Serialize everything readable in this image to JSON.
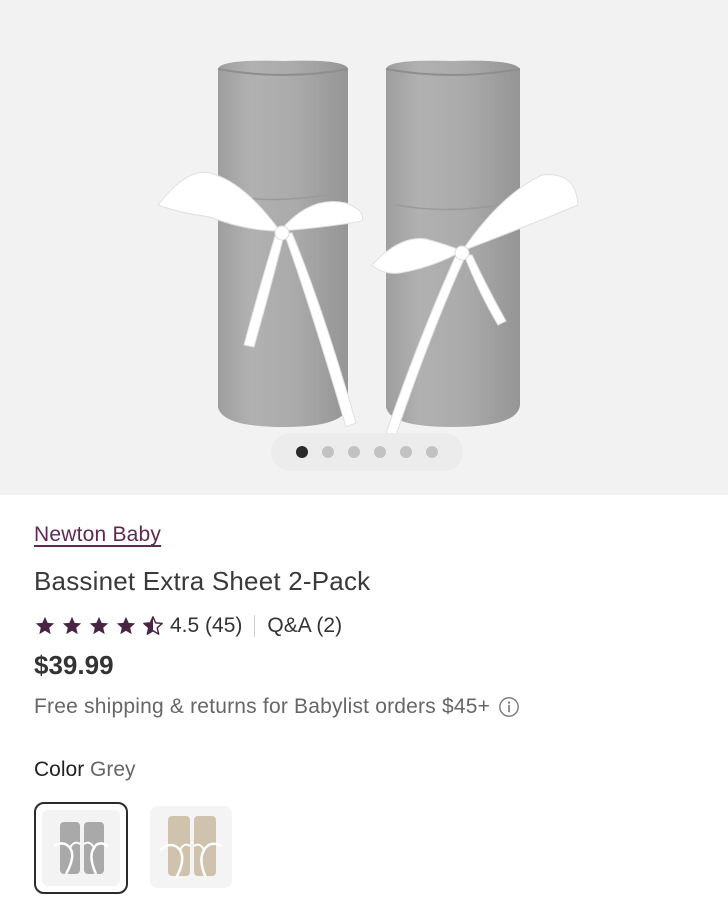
{
  "product": {
    "brand": "Newton Baby",
    "title": "Bassinet Extra Sheet 2-Pack",
    "rating_value": 4.5,
    "rating_text": "4.5 (45)",
    "qa_text": "Q&A (2)",
    "price": "$39.99",
    "shipping_text": "Free shipping & returns for Babylist orders $45+",
    "color_label": "Color",
    "color_value": "Grey"
  },
  "gallery": {
    "image_count": 6,
    "active_index": 0
  },
  "swatches": [
    {
      "name": "Grey",
      "selected": true
    },
    {
      "name": "Sand",
      "selected": false
    }
  ],
  "colors": {
    "brand": "#5e2a52",
    "star": "#4a2443",
    "fabric_grey": "#a9a9a9",
    "fabric_sand": "#cfc3ae",
    "ribbon": "#ffffff"
  }
}
